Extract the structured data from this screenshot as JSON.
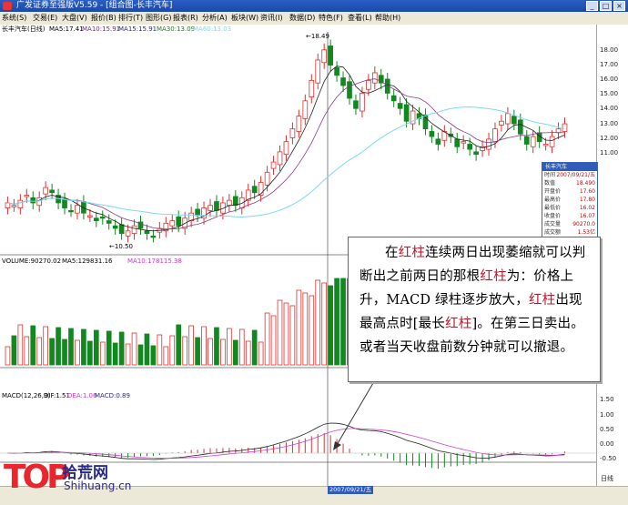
{
  "window": {
    "title": "广发证券至强版V5.59 - [组合图-长丰汽车]"
  },
  "menu": [
    "系统(S)",
    "交易(E)",
    "大盘(V)",
    "报价(B)",
    "排行(T)",
    "图形(G)",
    "报表(R)",
    "分析(A)",
    "板块(W)",
    "资讯(I)",
    "数据(D)",
    "特色(F)",
    "查看(L)",
    "帮助(H)"
  ],
  "price_panel": {
    "header": {
      "name": "长丰汽车(日线)",
      "ma5": "MA5:17.41",
      "ma10": "MA10:15.91",
      "ma15": "MA15:15.91",
      "ma30": "MA30:13.09",
      "ma60": "MA60:13.03"
    },
    "high_label": "←18.49",
    "low_label": "←10.50",
    "y_ticks": [
      "18.00",
      "17.00",
      "16.00",
      "15.00",
      "14.00",
      "13.00",
      "12.00",
      "11.00"
    ]
  },
  "volume_panel": {
    "header": {
      "name": "VOLUME:90270.02",
      "ma5": "MA5:129831.16",
      "ma10": "MA10:178115.38"
    }
  },
  "macd_panel": {
    "header": {
      "name": "MACD(12,26,9)",
      "dif": "DIF:1.51",
      "dea": "DEA:1.06",
      "macd": "MACD:0.89"
    },
    "y_ticks": [
      "1.50",
      "1.00",
      "0.50",
      "0.00",
      "-0.50"
    ]
  },
  "info_box": {
    "title": "长丰汽车",
    "rows": [
      {
        "k": "时间",
        "v": "2007/09/21/五"
      },
      {
        "k": "数值",
        "v": "18.490"
      },
      {
        "k": "开盘价",
        "v": "17.60"
      },
      {
        "k": "最高价",
        "v": "17.80"
      },
      {
        "k": "最低价",
        "v": "16.02"
      },
      {
        "k": "收盘价",
        "v": "16.07"
      },
      {
        "k": "成交量",
        "v": "90270.0"
      },
      {
        "k": "成交额",
        "v": "1.53亿"
      },
      {
        "k": "涨幅",
        "v": "-0.64(-3.84%)"
      },
      {
        "k": "振幅",
        "v": "11.41%"
      }
    ]
  },
  "callout": {
    "parts": [
      {
        "t": "在",
        "red": false
      },
      {
        "t": "红柱",
        "red": true
      },
      {
        "t": "连续两日出现萎缩就可以判断出之前两日的那根",
        "red": false
      },
      {
        "t": "红柱",
        "red": true
      },
      {
        "t": "为：价格上升，MACD 绿柱逐步放大，",
        "red": false
      },
      {
        "t": "红柱",
        "red": true
      },
      {
        "t": "出现最高点时[最长",
        "red": false
      },
      {
        "t": "红柱",
        "red": true
      },
      {
        "t": "]。在第三日卖出。或者当天收盘前数分钟就可以撤退。",
        "red": false
      }
    ]
  },
  "status": {
    "date": "2007/09/21/五",
    "day": "日线"
  },
  "watermark": {
    "a": "TOP",
    "b": "拾荒网",
    "c": "Shihuang.cn"
  },
  "colors": {
    "up": "#e03030",
    "down": "#118820",
    "ma5": "#222222",
    "ma10": "#8a3a8a",
    "ma30": "#7fd8ee",
    "macd_dif": "#222222",
    "macd_dea": "#d040d0"
  }
}
